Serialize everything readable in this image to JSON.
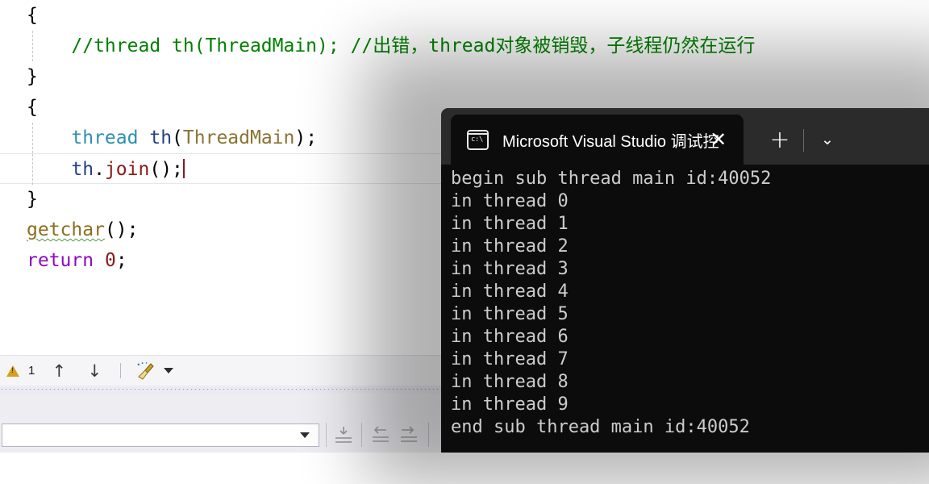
{
  "editor": {
    "lines": [
      {
        "indent_guide": false,
        "tokens": [
          {
            "t": "brace",
            "s": "{"
          }
        ]
      },
      {
        "indent_guide": true,
        "tokens": [
          {
            "t": "comment",
            "s": "    //thread th(ThreadMain); //出错，thread对象被销毁，子线程仍然在运行"
          }
        ]
      },
      {
        "indent_guide": false,
        "tokens": [
          {
            "t": "brace",
            "s": "}"
          }
        ]
      },
      {
        "indent_guide": false,
        "tokens": [
          {
            "t": "brace",
            "s": "{"
          }
        ]
      },
      {
        "indent_guide": true,
        "tokens": [
          {
            "t": "plain",
            "s": "    "
          },
          {
            "t": "type",
            "s": "thread"
          },
          {
            "t": "plain",
            "s": " "
          },
          {
            "t": "var",
            "s": "th"
          },
          {
            "t": "punc",
            "s": "("
          },
          {
            "t": "class",
            "s": "ThreadMain"
          },
          {
            "t": "punc",
            "s": ");"
          }
        ]
      },
      {
        "indent_guide": true,
        "current": true,
        "tokens": [
          {
            "t": "plain",
            "s": "    "
          },
          {
            "t": "var",
            "s": "th"
          },
          {
            "t": "punc",
            "s": "."
          },
          {
            "t": "func",
            "s": "join"
          },
          {
            "t": "punc",
            "s": "();"
          },
          {
            "t": "caret",
            "s": ""
          }
        ]
      },
      {
        "indent_guide": false,
        "tokens": [
          {
            "t": "brace",
            "s": "}"
          }
        ]
      },
      {
        "indent_guide": false,
        "tokens": [
          {
            "t": "fn2sq",
            "s": "getchar"
          },
          {
            "t": "punc",
            "s": "();"
          }
        ]
      },
      {
        "indent_guide": false,
        "tokens": [
          {
            "t": "kw",
            "s": "return"
          },
          {
            "t": "plain",
            "s": " "
          },
          {
            "t": "num",
            "s": "0"
          },
          {
            "t": "punc",
            "s": ";"
          }
        ]
      }
    ],
    "colors": {
      "comment": "#008000",
      "type": "#2B91AF",
      "variable": "#27408B",
      "class": "#8B7333",
      "function": "#8B1A1A",
      "keyword": "#8F08C4",
      "number": "#8B1A1A",
      "squiggle": "#4E9A3F",
      "background": "#FFFFFF"
    }
  },
  "error_toolbar": {
    "warning_icon": "warning-triangle-icon",
    "warning_count": "1",
    "prev_issue_icon": "↑",
    "next_issue_icon": "↓",
    "cleanup_icon": "broom-icon",
    "cleanup_dropdown_icon": "chevron-down-icon"
  },
  "bottom_pane": {
    "filter_combo_value": "",
    "filter_combo_placeholder": "",
    "combo_caret_icon": "chevron-down-icon",
    "icons": [
      "bookmark-icon",
      "previous-icon",
      "next-icon"
    ],
    "status_text": ""
  },
  "terminal": {
    "tab": {
      "icon": "cmd-prompt-icon",
      "title": "Microsoft Visual Studio 调试控",
      "close_icon": "close-icon"
    },
    "new_tab_icon": "plus-icon",
    "dropdown_icon": "chevron-down-icon",
    "colors": {
      "titlebar": "#2B2B2B",
      "tab_active": "#0C0C0C",
      "body_background": "#0C0C0C",
      "text": "#CCCCCC"
    },
    "output_lines": [
      "begin sub thread main id:40052",
      "in thread 0",
      "in thread 1",
      "in thread 2",
      "in thread 3",
      "in thread 4",
      "in thread 5",
      "in thread 6",
      "in thread 7",
      "in thread 8",
      "in thread 9",
      "end sub thread main id:40052"
    ]
  }
}
